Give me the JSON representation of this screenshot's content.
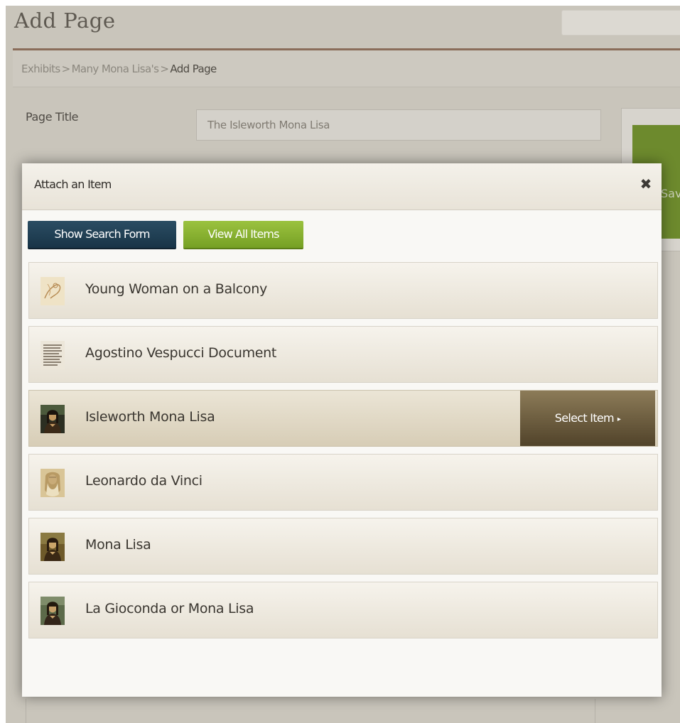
{
  "page": {
    "title": "Add Page",
    "breadcrumb": [
      "Exhibits",
      "Many Mona Lisa's",
      "Add Page"
    ],
    "breadcrumb_separator": ">",
    "field_label": "Page Title",
    "title_value": "The Isleworth Mona Lisa",
    "save_fragment": "Sav"
  },
  "modal": {
    "title": "Attach an Item",
    "close_symbol": "✖",
    "buttons": {
      "search": "Show Search Form",
      "view_all": "View All Items"
    },
    "select_label": "Select Item",
    "select_arrow": "▸",
    "items": [
      {
        "label": "Young Woman on a Balcony",
        "icon": "sketch-thumbnail-icon"
      },
      {
        "label": "Agostino Vespucci Document",
        "icon": "document-thumbnail-icon"
      },
      {
        "label": "Isleworth Mona Lisa",
        "icon": "portrait-thumbnail-icon",
        "active": true
      },
      {
        "label": "Leonardo da Vinci",
        "icon": "self-portrait-thumbnail-icon"
      },
      {
        "label": "Mona Lisa",
        "icon": "portrait-thumbnail-icon"
      },
      {
        "label": "La Gioconda or Mona Lisa",
        "icon": "portrait-thumbnail-icon"
      }
    ]
  },
  "colors": {
    "accent_green": "#8ab133",
    "navy": "#1f3d52",
    "select_brown": "#6e5f40",
    "title_rule": "#8a6d5a"
  }
}
